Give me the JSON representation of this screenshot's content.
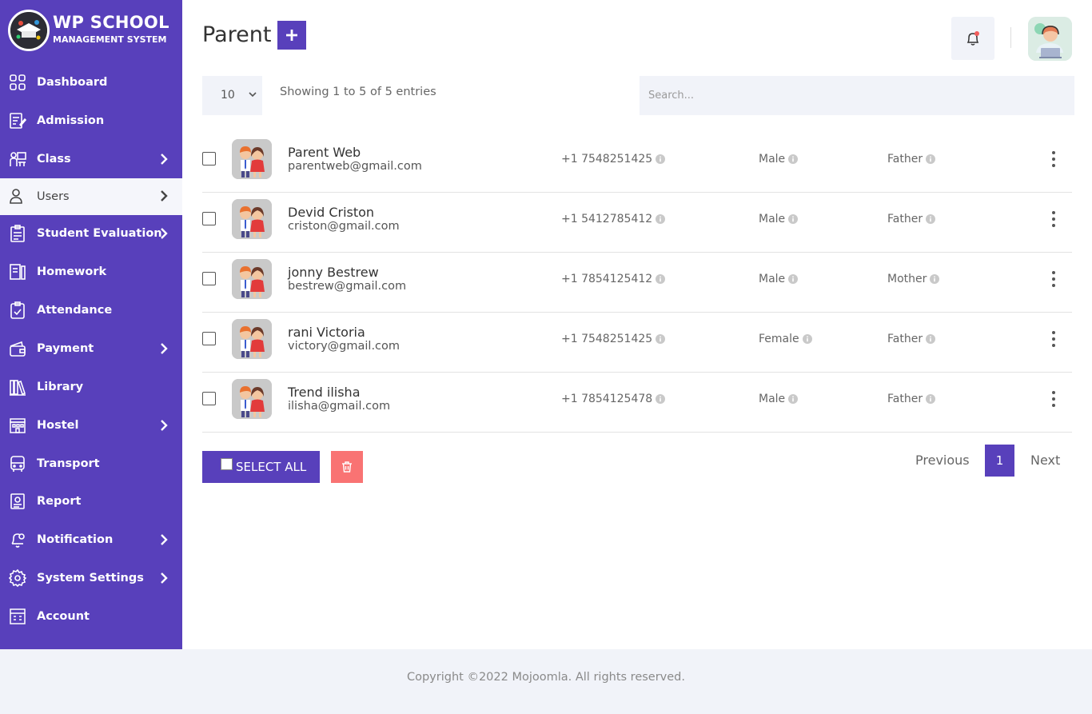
{
  "brand": {
    "title": "WP SCHOOL",
    "subtitle": "MANAGEMENT SYSTEM"
  },
  "sidebar": {
    "items": [
      {
        "label": "Dashboard",
        "icon": "dashboard-icon",
        "has_submenu": false
      },
      {
        "label": "Admission",
        "icon": "admission-icon",
        "has_submenu": false
      },
      {
        "label": "Class",
        "icon": "class-icon",
        "has_submenu": true
      },
      {
        "label": "Users",
        "icon": "user-icon",
        "has_submenu": true,
        "active": true
      },
      {
        "label": "Student Evaluation",
        "icon": "evaluation-icon",
        "has_submenu": true
      },
      {
        "label": "Homework",
        "icon": "homework-icon",
        "has_submenu": false
      },
      {
        "label": "Attendance",
        "icon": "attendance-icon",
        "has_submenu": false
      },
      {
        "label": "Payment",
        "icon": "wallet-icon",
        "has_submenu": true
      },
      {
        "label": "Library",
        "icon": "library-icon",
        "has_submenu": false
      },
      {
        "label": "Hostel",
        "icon": "hostel-icon",
        "has_submenu": true
      },
      {
        "label": "Transport",
        "icon": "bus-icon",
        "has_submenu": false
      },
      {
        "label": "Report",
        "icon": "report-icon",
        "has_submenu": false
      },
      {
        "label": "Notification",
        "icon": "notification-icon",
        "has_submenu": true
      },
      {
        "label": "System Settings",
        "icon": "gear-icon",
        "has_submenu": true
      },
      {
        "label": "Account",
        "icon": "account-icon",
        "has_submenu": false
      }
    ]
  },
  "header": {
    "title": "Parent",
    "add_icon": "plus-icon",
    "bell_icon": "bell-icon"
  },
  "table": {
    "page_length": "10",
    "info": "Showing 1 to 5 of 5 entries",
    "search_placeholder": "Search...",
    "rows": [
      {
        "name": "Parent Web",
        "email": "parentweb@gmail.com",
        "phone": "+1 7548251425",
        "gender": "Male",
        "relation": "Father"
      },
      {
        "name": "Devid Criston",
        "email": "criston@gmail.com",
        "phone": "+1 5412785412",
        "gender": "Male",
        "relation": "Father"
      },
      {
        "name": "jonny Bestrew",
        "email": "bestrew@gmail.com",
        "phone": "+1 7854125412",
        "gender": "Male",
        "relation": "Mother"
      },
      {
        "name": "rani Victoria",
        "email": "victory@gmail.com",
        "phone": "+1 7548251425",
        "gender": "Female",
        "relation": "Father"
      },
      {
        "name": "Trend ilisha",
        "email": "ilisha@gmail.com",
        "phone": "+1 7854125478",
        "gender": "Male",
        "relation": "Father"
      }
    ]
  },
  "actions": {
    "select_all": "SELECT ALL",
    "delete_icon": "trash-icon"
  },
  "pagination": {
    "previous": "Previous",
    "current": "1",
    "next": "Next"
  },
  "footer": {
    "text": "Copyright ©2022 Mojoomla. All rights reserved."
  },
  "colors": {
    "primary": "#5840bb",
    "danger": "#f97373",
    "panel": "#f1f3f9"
  }
}
